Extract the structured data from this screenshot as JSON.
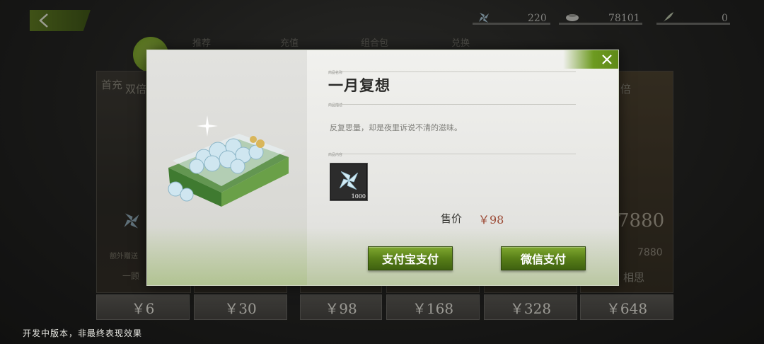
{
  "topbar": {
    "currencies": [
      {
        "icon": "jade-flower-icon",
        "value": "220"
      },
      {
        "icon": "tea-bowl-icon",
        "value": "78101"
      },
      {
        "icon": "feather-icon",
        "value": "0"
      }
    ]
  },
  "tabs": [
    "推荐",
    "充值",
    "组合包",
    "兑换"
  ],
  "background_cards": {
    "left_texts": [
      "首充",
      "双倍"
    ],
    "right_texts": [
      "倍"
    ],
    "left_misc": [
      "额外赠送",
      "一顾"
    ],
    "right_amount": "7880",
    "right_amount_small": "7880",
    "right_caption": "相思",
    "prices": [
      "￥6",
      "￥30",
      "￥98",
      "￥168",
      "￥328",
      "￥648"
    ]
  },
  "modal": {
    "name_label": "商品名称",
    "title": "一月复想",
    "desc_label": "商品描述",
    "description": "反复思量，却是夜里诉说不清的滋味。",
    "contents_label": "商品内容",
    "item_count": "1000",
    "price_label": "售价",
    "price_value": "￥98",
    "alipay_label": "支付宝支付",
    "wechat_label": "微信支付"
  },
  "footer_note": "开发中版本，非最终表现效果",
  "colors": {
    "accent_green": "#5f8a18",
    "price_red": "#9c4a35"
  }
}
